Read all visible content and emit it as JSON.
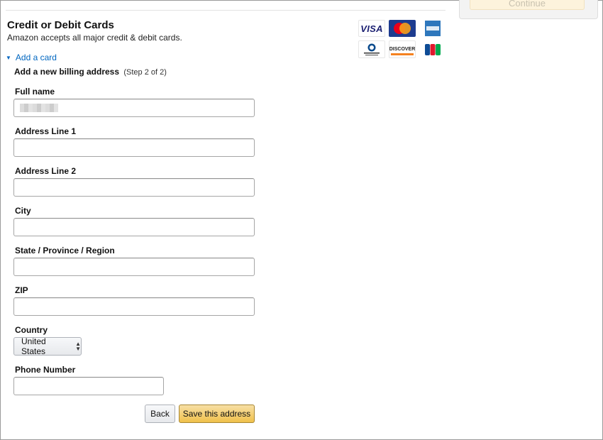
{
  "side_panel": {
    "continue_label": "Continue"
  },
  "header": {
    "title": "Credit or Debit Cards",
    "subtitle": "Amazon accepts all major credit & debit cards."
  },
  "add_card": {
    "link_label": "Add a card"
  },
  "billing": {
    "heading": "Add a new billing address",
    "step": "(Step 2 of 2)"
  },
  "fields": {
    "full_name": {
      "label": "Full name",
      "value": ""
    },
    "address1": {
      "label": "Address Line 1",
      "value": ""
    },
    "address2": {
      "label": "Address Line 2",
      "value": ""
    },
    "city": {
      "label": "City",
      "value": ""
    },
    "state": {
      "label": "State / Province / Region",
      "value": ""
    },
    "zip": {
      "label": "ZIP",
      "value": ""
    },
    "country": {
      "label": "Country",
      "selected": "United States"
    },
    "phone": {
      "label": "Phone Number",
      "value": ""
    }
  },
  "buttons": {
    "back_label": "Back",
    "save_label": "Save this address"
  },
  "card_logos": {
    "visa": "VISA",
    "mastercard": "MasterCard",
    "amex": "American Express",
    "diners": "Diners Club International",
    "discover": "DISCOVER",
    "jcb": "JCB"
  },
  "colors": {
    "link": "#0066c0",
    "primary_button": "#f0c14b",
    "visa": "#1a1f71",
    "mastercard_red": "#eb001b",
    "mastercard_yellow": "#f79e1b",
    "amex": "#2e77bc",
    "discover_orange": "#f58220"
  },
  "icons": {
    "add_card_caret": "caret-down-icon",
    "select_arrows": "up-down-arrows-icon"
  }
}
